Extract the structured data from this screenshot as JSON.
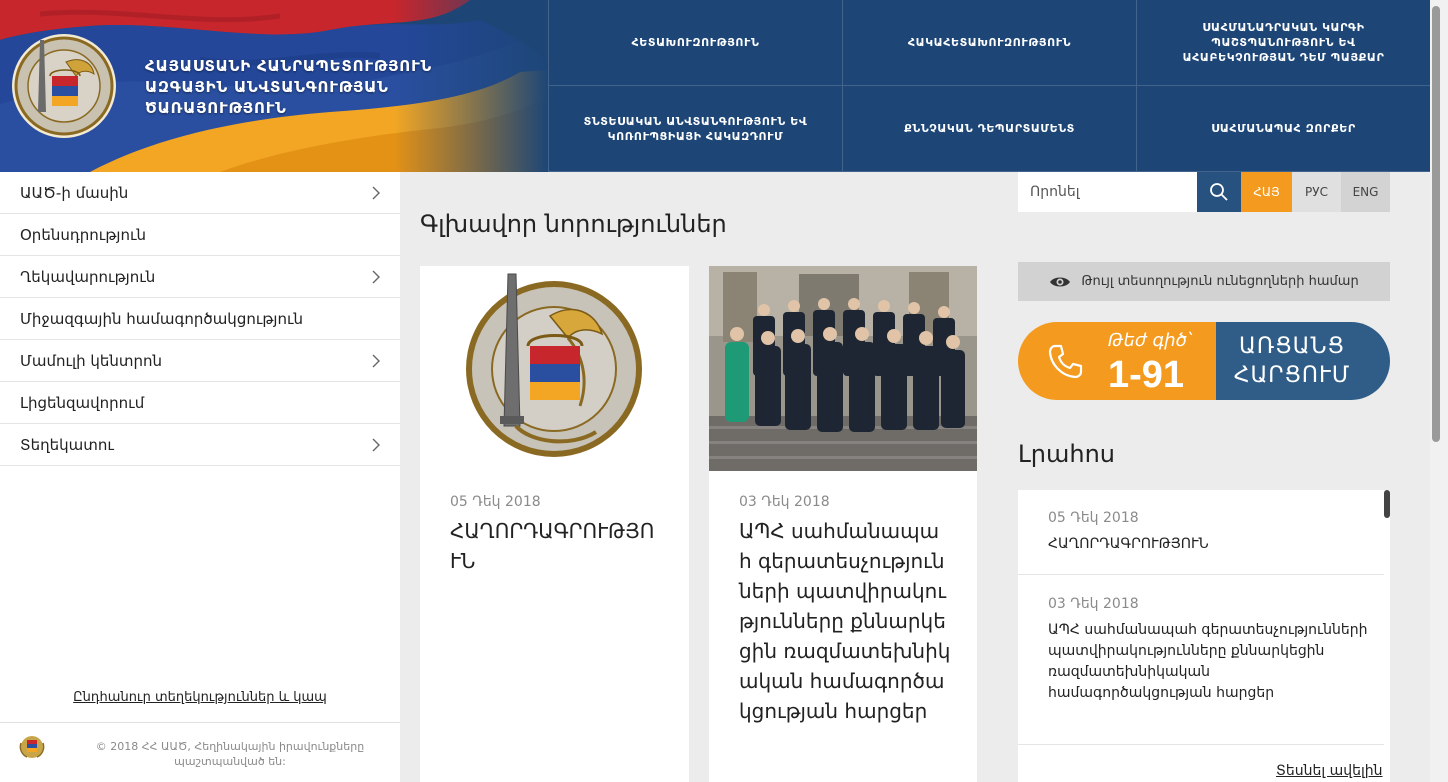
{
  "brand": {
    "title": "ՀԱՅԱՍՏԱՆԻ ՀԱՆՐԱՊԵՏՈՒԹՅՈՒՆ ԱԶԳԱՅԻՆ ԱՆՎՏԱՆԳՈՒԹՅԱՆ ԾԱՌԱՅՈՒԹՅՈՒՆ"
  },
  "top_nav": [
    "ՀԵՏԱԽՈՒԶՈՒԹՅՈՒՆ",
    "ՀԱԿԱՀԵՏԱԽՈՒԶՈՒԹՅՈՒՆ",
    "ՍԱՀՄԱՆԱԴՐԱԿԱՆ ԿԱՐԳԻ ՊԱՇՏՊԱՆՈՒԹՅՈՒՆ ԵՎ ԱՀԱԲԵԿՉՈՒԹՅԱՆ ԴԵՄ ՊԱՅՔԱՐ",
    "ՏՆՏԵՍԱԿԱՆ ԱՆՎՏԱՆԳՈՒԹՅՈՒՆ ԵՎ ԿՈՌՈՒՊՑԻԱՅԻ ՀԱԿԱԶԴՈՒՄ",
    "ՔՆՆՉԱԿԱՆ ԴԵՊԱՐՏԱՄԵՆՏ",
    "ՍԱՀՄԱՆԱՊԱՀ ԶՈՐՔԵՐ"
  ],
  "sidebar": {
    "items": [
      {
        "label": "ԱԱԾ-ի մասին",
        "has_children": true
      },
      {
        "label": "Օրենսդրություն",
        "has_children": false
      },
      {
        "label": "Ղեկավարություն",
        "has_children": true
      },
      {
        "label": "Միջազգային համագործակցություն",
        "has_children": false
      },
      {
        "label": "Մամուլի կենտրոն",
        "has_children": true
      },
      {
        "label": "Լիցենզավորում",
        "has_children": false
      },
      {
        "label": "Տեղեկատու",
        "has_children": true
      }
    ],
    "contact_link": "Ընդհանուր տեղեկություններ և կապ",
    "copyright": "© 2018 ՀՀ ԱԱԾ, Հեղինակային իրավունքները պաշտպանված են:"
  },
  "main": {
    "section_title": "Գլխավոր նորություններ",
    "cards": [
      {
        "date": "05 Դեկ 2018",
        "title": "ՀԱՂՈՐԴԱԳՐՈՒԹՅՈՒՆ"
      },
      {
        "date": "03 Դեկ 2018",
        "title": "ԱՊՀ սահմանապահ գերատեսչությունների պատվիրակությունները քննարկեցին ռազմատեխնիկական համագործակցության հարցեր"
      }
    ]
  },
  "search": {
    "placeholder": "Որոնել"
  },
  "languages": [
    "ՀԱՅ",
    "РУС",
    "ENG"
  ],
  "vision_label": "Թույլ տեսողություն ունեցողների համար",
  "hotline": {
    "label": "Թեժ գիծ՝",
    "number": "1-91",
    "cta_line1": "ԱՌՑԱՆՑ",
    "cta_line2": "ՀԱՐՑՈՒՄ"
  },
  "feed": {
    "title": "Լրահոս",
    "items": [
      {
        "date": "05 Դեկ 2018",
        "text": "ՀԱՂՈՐԴԱԳՐՈՒԹՅՈՒՆ"
      },
      {
        "date": "03 Դեկ 2018",
        "text": "ԱՊՀ սահմանապահ գերատեսչությունների պատվիրակությունները քննարկեցին ռազմատեխնիկական համագործակցության հարցեր"
      }
    ],
    "more": "Տեսնել ավելին"
  },
  "colors": {
    "primary": "#1d4677",
    "accent": "#f39a1f",
    "hotline_blue": "#2f5d88"
  }
}
